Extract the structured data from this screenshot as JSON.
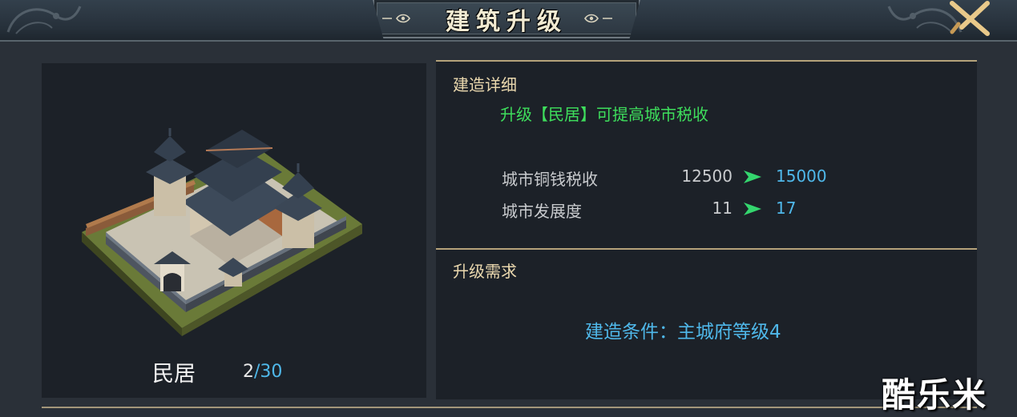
{
  "header": {
    "title": "建筑升级"
  },
  "building": {
    "name": "民居",
    "level_current": "2",
    "level_separator": "/",
    "level_max": "30"
  },
  "details": {
    "section_title": "建造详细",
    "description": "升级【民居】可提高城市税收",
    "stats": [
      {
        "label": "城市铜钱税收",
        "current": "12500",
        "next": "15000"
      },
      {
        "label": "城市发展度",
        "current": "11",
        "next": "17"
      }
    ]
  },
  "requirements": {
    "section_title": "升级需求",
    "condition": "建造条件：主城府等级4"
  },
  "watermark": "酷乐米",
  "colors": {
    "accent_blue": "#4fb8ea",
    "accent_green": "#3ede5c",
    "gold_line": "#b5a27a",
    "panel_bg": "#1c2128"
  },
  "icons": {
    "close": "close-icon",
    "arrow": "arrow-right-icon"
  }
}
